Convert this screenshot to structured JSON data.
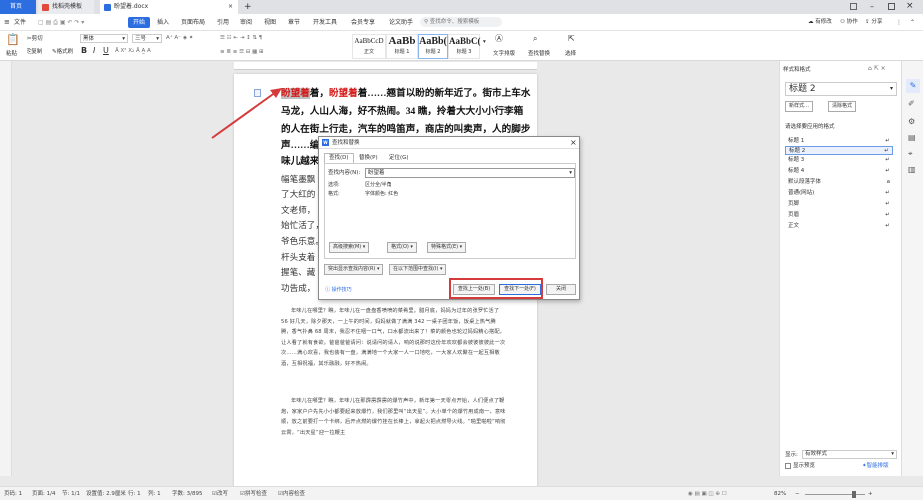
{
  "tabs": {
    "home": "首页",
    "template": "找稻壳模板",
    "doc": "盼望着.docx"
  },
  "menu": {
    "file": "文件",
    "start": "开始",
    "insert": "插入",
    "layout": "页面布局",
    "reference": "引用",
    "review": "审阅",
    "view": "视图",
    "section": "章节",
    "dev": "开发工具",
    "member": "会员专享",
    "thesis": "论文助手",
    "search": "查找命令、搜索模板",
    "unsaved": "有修改",
    "collab": "协作",
    "share": "分享"
  },
  "ribbon": {
    "paste": "粘贴",
    "cut": "剪切",
    "copy": "复制",
    "format_painter": "格式刷",
    "font": "黑体",
    "size": "三号",
    "bold": "B",
    "italic": "I",
    "underline": "U",
    "normal": "正文",
    "h1": "标题 1",
    "h2": "标题 2",
    "h3": "标题 3",
    "s_normal": "AaBbCcD",
    "s_h1": "AaBb",
    "s_h2": "AaBb(",
    "s_h3": "AaBbC(",
    "text_tools": "文字排版",
    "find_replace": "查找替换",
    "select": "选择"
  },
  "doc": {
    "lines": [
      [
        "盼望着",
        "着，",
        "盼望着",
        "着……翘首以盼的新年近了。街市上车水"
      ],
      [
        "马龙，人山人海，好不热闹。34 瞧，拎着大大小小行李箱"
      ],
      [
        "的人在街上行走，汽车的鸣笛声，商店的叫卖声，人的脚步"
      ],
      [
        "声……编"
      ],
      [
        "味儿越来"
      ]
    ],
    "mid": [
      "幅笔墨飘",
      "了大红的",
      "文老师，",
      "始忙活了，",
      "爷色乐意。",
      "杆头支着",
      "握笔、藏",
      "功告成，"
    ],
    "para1": "年味儿在哪里？瞧，年味儿在一盘盘香喷喷的菜肴里。腊月底，妈妈为过年的张罗忙活了 56 好几天，除夕那天，一上午的时间，妈妈就做了满满 342 一桌子团年饭，饭桌上热气腾腾，香气扑鼻 68 周末，我忍不住咽一口气，口水都流出来了！菜的颜色也轮过妈妈精心搭配，让人看了就有食欲。爸爸爸爸请问：说请问的请人，响的说那时这份年欢欢都会彼彼彼彼此一次次……满心欢喜，我也装有一盘，满满地一个大家一人一口地吃，一大家人欢聚在一起互相敬酒，互相祝福，其乐融融，好不热闹。",
    "para2": "年味儿在哪里？瞧，年味儿在那霹雳霹雳的爆竹声中，新年第一天零点开始，人们便点了鞭炮，家家户户先先小小都要起来放爆竹，我们那里叫“出天星”。大小单个的爆竹用成南一，意味顺，放之前要打一个卡绑，后开点燃的爆竹挂在长棒上，拿起火把点燃导火线。“啪里啪啦”响彻云霄，“出天星”迎一拉鞭主"
  },
  "dialog": {
    "title": "查找和替换",
    "tab_find": "查找(D)",
    "tab_replace": "替换(P)",
    "tab_goto": "定位(G)",
    "find_label": "查找内容(N):",
    "find_value": "盼望着",
    "options_label": "选项:",
    "options_value": "区分全/半角",
    "format_label": "格式:",
    "format_value": "字体颜色: 红色",
    "advanced": "高级搜索(M) ▾",
    "format_btn": "格式(O) ▾",
    "special": "特殊格式(E) ▾",
    "highlight": "突出显示查找内容(R) ▾",
    "range": "在以下范围中查找(I) ▾",
    "tips": "操作技巧",
    "find_prev": "查找上一处(B)",
    "find_next": "查找下一处(F)",
    "close": "关闭"
  },
  "panel": {
    "title": "样式和格式",
    "current": "标题 2",
    "new_style": "新样式…",
    "clear_format": "清除格式",
    "apply_label": "请选择要应用的格式",
    "styles": [
      "标题 1",
      "标题 2",
      "标题 3",
      "标题 4",
      "默认段落字体",
      "普通(网站)",
      "页脚",
      "页眉",
      "正文"
    ],
    "show_label": "显示:",
    "show_value": "有效样式",
    "preview": "显示预览",
    "smart": "智能排版"
  },
  "status": {
    "page": "页码: 1",
    "pages": "页面: 1/4",
    "section": "节: 1/1",
    "setting": "设置值: 2.9厘米",
    "row": "行: 1",
    "col": "列: 1",
    "words": "字数: 3/895",
    "revise": "改写",
    "spell": "拼写检查",
    "content": "内容检查",
    "zoom": "82%"
  },
  "colors": {
    "accent": "#2c6de0",
    "red": "#d41a1a",
    "arrow": "#d63b3b"
  }
}
